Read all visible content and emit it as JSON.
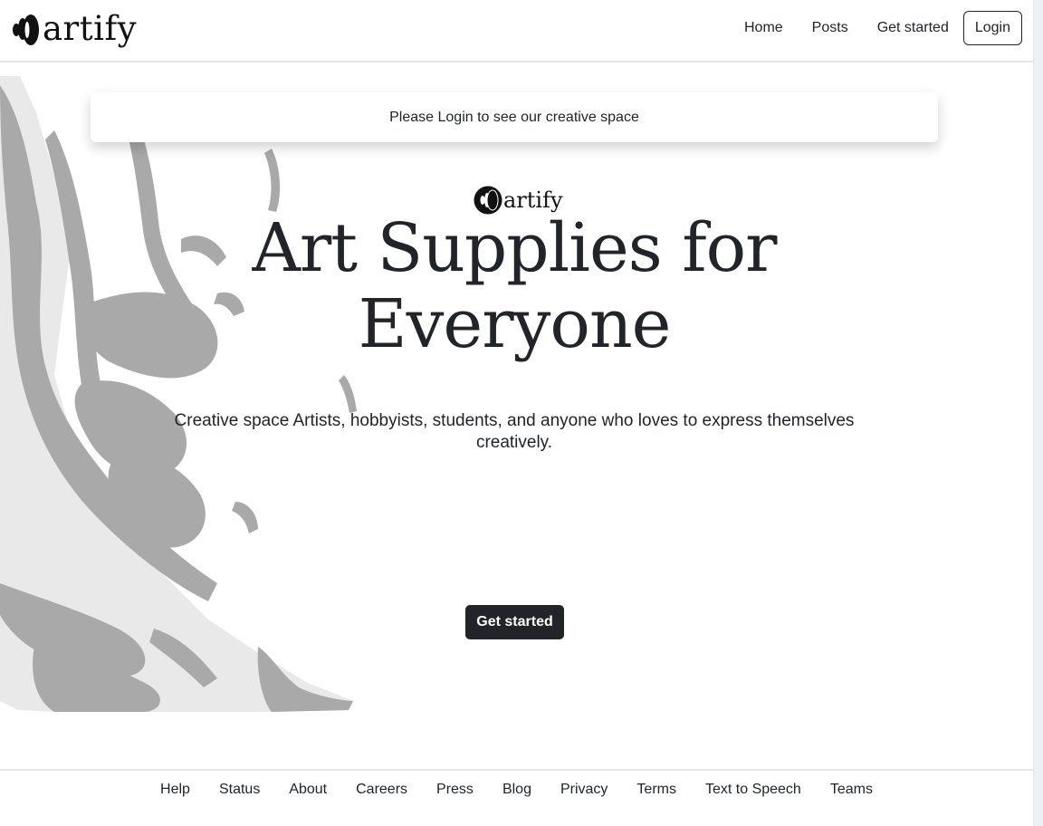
{
  "brand": {
    "name": "artify",
    "logo_icon": "artify-logo-icon"
  },
  "nav": {
    "links": [
      "Home",
      "Posts",
      "Get started"
    ],
    "login_label": "Login"
  },
  "alert": {
    "text": "Please Login to see our creative space"
  },
  "hero": {
    "logo_text": "artify",
    "title_line1": "Art Supplies for",
    "title_line2": "Everyone",
    "subtitle": "Creative space Artists, hobbyists, students, and anyone who loves to express themselves creatively.",
    "cta_label": "Get started",
    "background_art": "paint-splatter-illustration"
  },
  "footer": {
    "links": [
      "Help",
      "Status",
      "About",
      "Careers",
      "Press",
      "Blog",
      "Privacy",
      "Terms",
      "Text to Speech",
      "Teams"
    ]
  },
  "colors": {
    "text": "#212529",
    "button_dark": "#212529",
    "splatter": "#a9a9a9",
    "divider": "#e7e7e7"
  }
}
